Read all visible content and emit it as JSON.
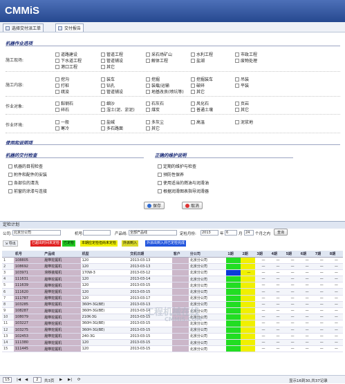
{
  "app": {
    "logo": "CMMiS"
  },
  "tabs": [
    {
      "label": "选择交付派工单"
    },
    {
      "label": "交付报告"
    }
  ],
  "form": {
    "section1_title": "机器作业选项",
    "rows": [
      {
        "label": "施工现场:",
        "options": [
          "道路建设",
          "管道工程",
          "采石场矿山",
          "水利工程",
          "市政工程",
          "下水道工程",
          "管道铺设",
          "解体工程",
          "盐湖",
          "废物处理",
          "港口工程",
          "其它"
        ]
      },
      {
        "label": "施工内容:",
        "options": [
          "挖沟",
          "装车",
          "挖掘",
          "挖掘装车",
          "吊装",
          "打桩",
          "钻孔",
          "装载/运输",
          "破碎",
          "平装",
          "疏浚",
          "管道铺设",
          "地基改良(喷坑等)",
          "其它"
        ]
      },
      {
        "label": "作业对象:",
        "options": [
          "黏钢石",
          "细沙",
          "石灰石",
          "风化石",
          "页岩",
          "碎石",
          "湿土(泥、淤泥)",
          "煤炭",
          "普通土壤",
          "其它"
        ]
      },
      {
        "label": "作业环境:",
        "options": [
          "一般",
          "盐碱",
          "多灰尘",
          "高温",
          "泥浆地",
          "寒冷",
          "多石路面",
          "其它"
        ]
      }
    ],
    "section2_title": "使用和说明项",
    "left_title": "机器的交付检查",
    "left_items": [
      "机器的目视检查",
      "附件和配件的安装",
      "各部位的清洗",
      "前窗的涂漆与连接"
    ],
    "right_title": "正确的维护说明",
    "right_items": [
      "定期的维护与检查",
      "预防性保养",
      "使用适当的燃油与润滑油",
      "根据润滑图表指导润滑器"
    ],
    "save_label": "保存",
    "cancel_label": "取消"
  },
  "lower": {
    "panel_title": "定检计划",
    "filter": {
      "company_label": "公司:",
      "company_value": "北京分公司",
      "model_label": "机号:",
      "product_label": "产品线:",
      "product_value": "全部产品线",
      "month_label": "定检月份:",
      "year": "2013",
      "year_unit": "年",
      "month": "6",
      "month_unit": "月",
      "days": "24",
      "days_unit": "个月之内",
      "query_label": "查询"
    },
    "export_label": "导出",
    "legends": [
      {
        "text": "已超出时间未定检",
        "color": "#e02020"
      },
      {
        "text": "已定检",
        "color": "#22cc22"
      },
      {
        "text": "本期应定检但尚未定检",
        "color": "#f0f000"
      },
      {
        "text": "外派到入",
        "color": "#d9d92a"
      },
      {
        "text": "外派出到入并已定检完成",
        "color": "#2255dd"
      }
    ],
    "columns": [
      "",
      "机号",
      "产品线",
      "机型",
      "交机日期",
      "客户",
      "分公司",
      "1期",
      "2期",
      "3期",
      "4期",
      "5期",
      "6期",
      "7期",
      "8期"
    ],
    "rows": [
      {
        "no": "1",
        "id": "108805",
        "line": "履带挖掘机",
        "model": "120",
        "date": "2013-03-13",
        "branch": "北京分公司"
      },
      {
        "no": "2",
        "id": "108692",
        "line": "履带挖掘机",
        "model": "120",
        "date": "2013-03-13",
        "branch": "北京分公司"
      },
      {
        "no": "3",
        "id": "103971",
        "line": "滑移装载机",
        "model": "170W-3",
        "date": "2013-03-12",
        "branch": "北京分公司"
      },
      {
        "no": "4",
        "id": "111631",
        "line": "履带挖掘机",
        "model": "120",
        "date": "2013-03-14",
        "branch": "北京分公司"
      },
      {
        "no": "5",
        "id": "111639",
        "line": "履带挖掘机",
        "model": "120",
        "date": "2013-03-15",
        "branch": "北京分公司"
      },
      {
        "no": "6",
        "id": "111620",
        "line": "履带挖掘机",
        "model": "120",
        "date": "2013-03-15",
        "branch": "北京分公司"
      },
      {
        "no": "7",
        "id": "111787",
        "line": "履带挖掘机",
        "model": "120",
        "date": "2013-03-17",
        "branch": "北京分公司"
      },
      {
        "no": "8",
        "id": "103285",
        "line": "履带挖掘机",
        "model": "360H-3G(BE)",
        "date": "2013-03-13",
        "branch": "北京分公司"
      },
      {
        "no": "9",
        "id": "108287",
        "line": "履带挖掘机",
        "model": "360H-3G(BE)",
        "date": "2013-03-14",
        "branch": "北京分公司"
      },
      {
        "no": "10",
        "id": "108079",
        "line": "履带挖掘机",
        "model": "210K-3G",
        "date": "2013-03-15",
        "branch": "北京分公司"
      },
      {
        "no": "11",
        "id": "103227",
        "line": "履带挖掘机",
        "model": "360H-3G(BE)",
        "date": "2013-03-15",
        "branch": "北京分公司"
      },
      {
        "no": "12",
        "id": "103275",
        "line": "履带挖掘机",
        "model": "360H-3G(BE)",
        "date": "2013-03-15",
        "branch": "北京分公司"
      },
      {
        "no": "13",
        "id": "102453",
        "line": "履带挖掘机",
        "model": "240-3G",
        "date": "2013-03-15",
        "branch": "北京分公司"
      },
      {
        "no": "14",
        "id": "111380",
        "line": "履带挖掘机",
        "model": "120",
        "date": "2013-03-15",
        "branch": "北京分公司"
      },
      {
        "no": "15",
        "id": "111445",
        "line": "履带挖掘机",
        "model": "120",
        "date": "2013-03-15",
        "branch": "北京分公司"
      }
    ],
    "dash": "—",
    "pager": {
      "page_size": "15",
      "page": "2",
      "total_pages": "共3页",
      "info": "显示16到30,共37记录"
    },
    "watermark": "工程机械在线",
    "watermark2": "CMMiS.COM"
  },
  "colors": {
    "header": "#3458a4",
    "status_green": "#22dd22",
    "status_yellow": "#f0f000",
    "status_blue": "#0a3bd6"
  }
}
